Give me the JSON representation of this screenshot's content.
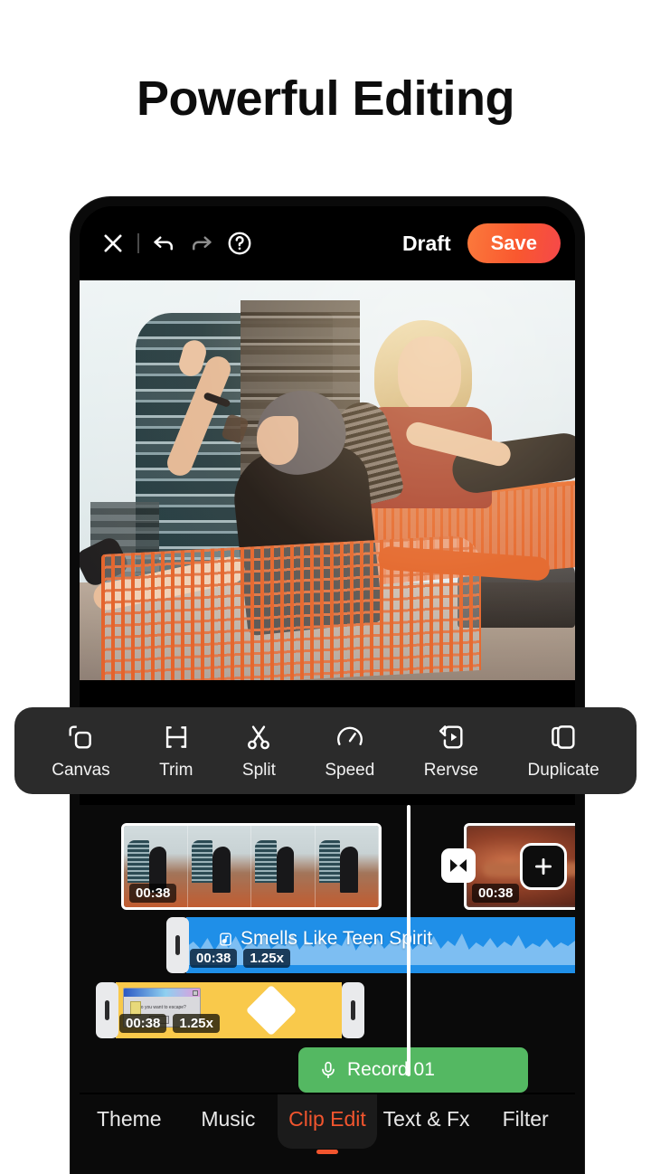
{
  "headline": "Powerful Editing",
  "topbar": {
    "close_icon": "close-icon",
    "undo_icon": "undo-icon",
    "redo_icon": "redo-icon",
    "help_icon": "help-circle-icon",
    "draft_label": "Draft",
    "save_label": "Save",
    "save_gradient_from": "#fb7a3c",
    "save_gradient_to": "#f5484a"
  },
  "tools": [
    {
      "label": "Canvas",
      "icon": "canvas-icon"
    },
    {
      "label": "Trim",
      "icon": "trim-icon"
    },
    {
      "label": "Split",
      "icon": "scissors-icon"
    },
    {
      "label": "Speed",
      "icon": "speedometer-icon"
    },
    {
      "label": "Rervse",
      "icon": "reverse-icon"
    },
    {
      "label": "Duplicate",
      "icon": "duplicate-icon"
    }
  ],
  "timeline": {
    "clips": [
      {
        "duration": "00:38",
        "selected": true
      },
      {
        "duration": "00:38",
        "selected": false
      }
    ],
    "transition_icon": "transition-icon",
    "add_clip_icon": "plus-icon",
    "music": {
      "title": "Smells Like Teen Spirit",
      "icon": "music-note-icon",
      "duration": "00:38",
      "speed": "1.25x",
      "color": "#1f8fe8"
    },
    "sticker": {
      "duration": "00:38",
      "speed": "1.25x",
      "color": "#f9c94b",
      "keyframe_icon": "keyframe-diamond-icon"
    },
    "record": {
      "label": "Record 01",
      "icon": "microphone-icon",
      "color": "#54b862"
    }
  },
  "tabs": [
    {
      "label": "Theme",
      "active": false
    },
    {
      "label": "Music",
      "active": false
    },
    {
      "label": "Clip Edit",
      "active": true
    },
    {
      "label": "Text & Fx",
      "active": false
    },
    {
      "label": "Filter",
      "active": false
    }
  ],
  "accent_color": "#f2552e"
}
